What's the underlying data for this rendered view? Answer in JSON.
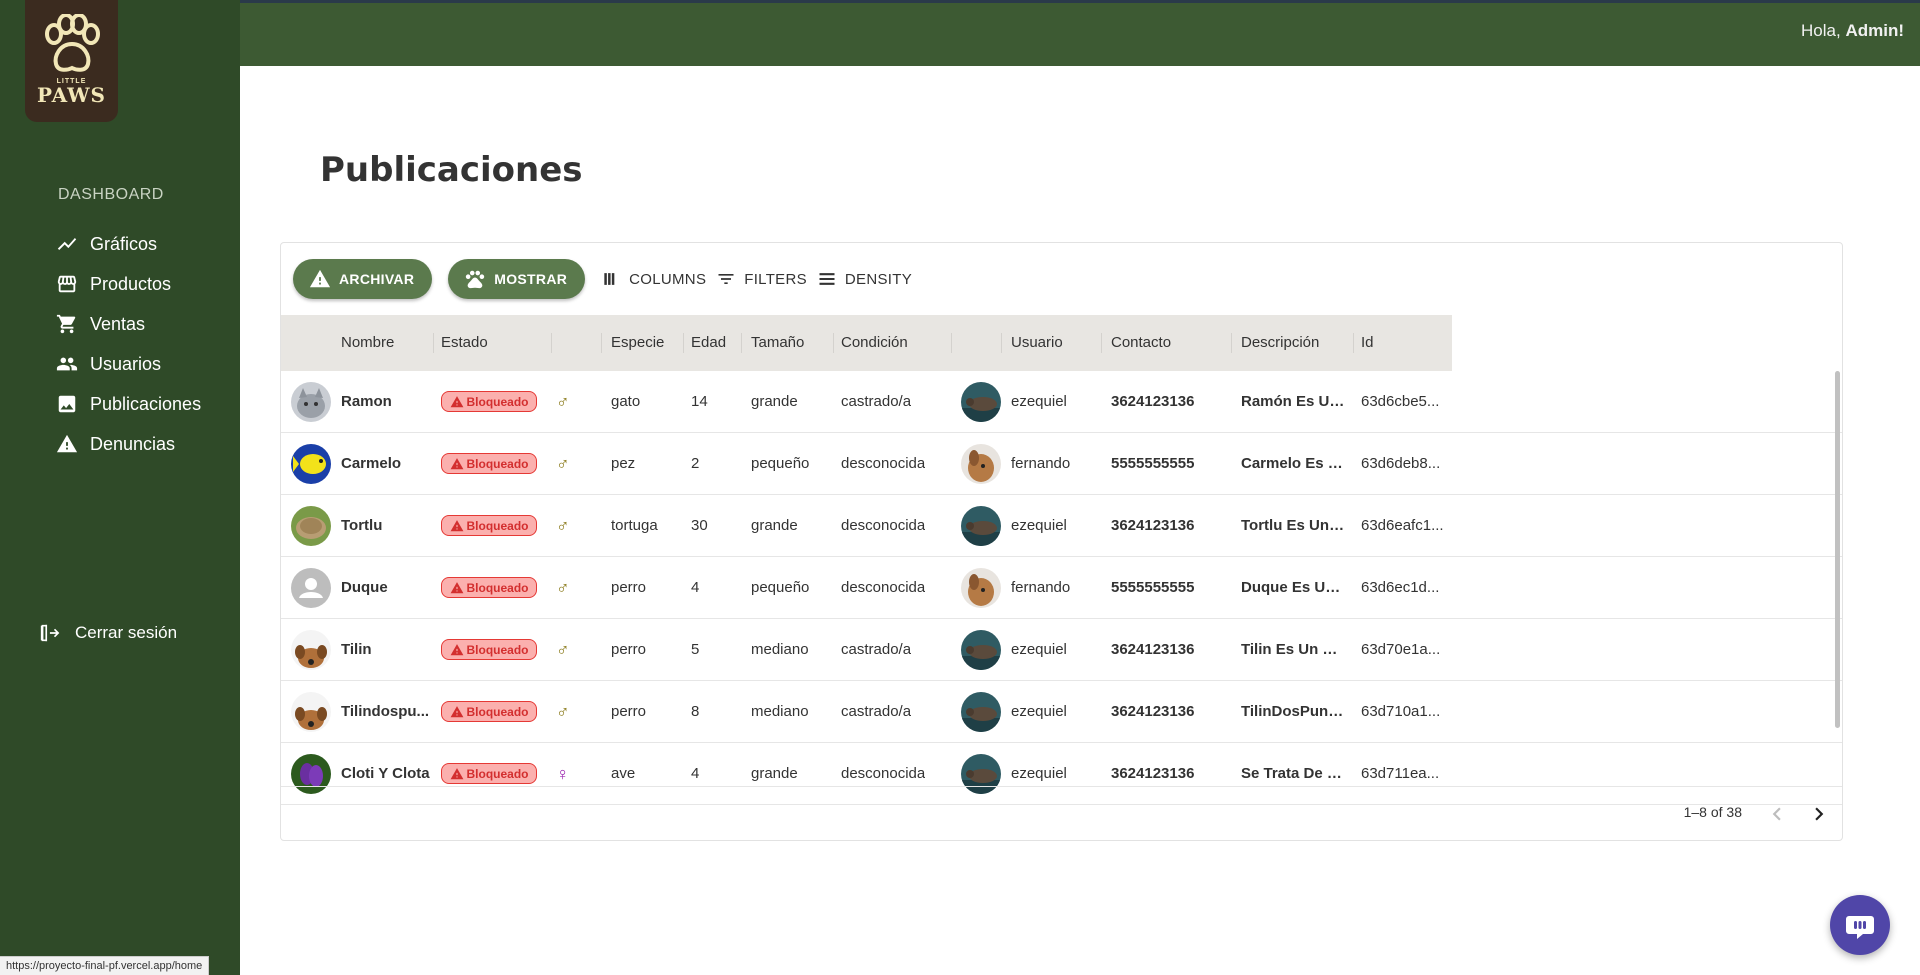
{
  "topbar": {
    "greeting_prefix": "Hola, ",
    "greeting_name": "Admin!"
  },
  "logo": {
    "small": "LITTLE",
    "big": "PAWS"
  },
  "sidebar": {
    "section_label": "DASHBOARD",
    "items": [
      {
        "label": "Gráficos",
        "icon": "chart-line-icon"
      },
      {
        "label": "Productos",
        "icon": "store-icon"
      },
      {
        "label": "Ventas",
        "icon": "cart-icon"
      },
      {
        "label": "Usuarios",
        "icon": "users-icon"
      },
      {
        "label": "Publicaciones",
        "icon": "image-icon"
      },
      {
        "label": "Denuncias",
        "icon": "warning-icon"
      }
    ],
    "logout_label": "Cerrar sesión"
  },
  "status_url": "https://proyecto-final-pf.vercel.app/home",
  "page": {
    "title": "Publicaciones"
  },
  "toolbar": {
    "archive_label": "ARCHIVAR",
    "show_label": "MOSTRAR",
    "columns_label": "COLUMNS",
    "filters_label": "FILTERS",
    "density_label": "DENSITY"
  },
  "table": {
    "headers": {
      "nombre": "Nombre",
      "estado": "Estado",
      "especie": "Especie",
      "edad": "Edad",
      "tamano": "Tamaño",
      "condicion": "Condición",
      "usuario": "Usuario",
      "contacto": "Contacto",
      "descripcion": "Descripción",
      "id": "Id"
    },
    "rows": [
      {
        "nombre": "Ramon",
        "estado": "Bloqueado",
        "genero": "♂",
        "especie": "gato",
        "edad": "14",
        "tamano": "grande",
        "condicion": "castrado/a",
        "usuario": "ezequiel",
        "contacto": "3624123136",
        "descripcion": "Ramón Es Un ...",
        "id": "63d6cbe5..."
      },
      {
        "nombre": "Carmelo",
        "estado": "Bloqueado",
        "genero": "♂",
        "especie": "pez",
        "edad": "2",
        "tamano": "pequeño",
        "condicion": "desconocida",
        "usuario": "fernando",
        "contacto": "5555555555",
        "descripcion": "Carmelo Es U...",
        "id": "63d6deb8..."
      },
      {
        "nombre": "Tortlu",
        "estado": "Bloqueado",
        "genero": "♂",
        "especie": "tortuga",
        "edad": "30",
        "tamano": "grande",
        "condicion": "desconocida",
        "usuario": "ezequiel",
        "contacto": "3624123136",
        "descripcion": "Tortlu Es Una ...",
        "id": "63d6eafc1..."
      },
      {
        "nombre": "Duque",
        "estado": "Bloqueado",
        "genero": "♂",
        "especie": "perro",
        "edad": "4",
        "tamano": "pequeño",
        "condicion": "desconocida",
        "usuario": "fernando",
        "contacto": "5555555555",
        "descripcion": "Duque Es Un ...",
        "id": "63d6ec1d..."
      },
      {
        "nombre": "Tilin",
        "estado": "Bloqueado",
        "genero": "♂",
        "especie": "perro",
        "edad": "5",
        "tamano": "mediano",
        "condicion": "castrado/a",
        "usuario": "ezequiel",
        "contacto": "3624123136",
        "descripcion": "Tilin Es Un Pe...",
        "id": "63d70e1a..."
      },
      {
        "nombre": "Tilindospu...",
        "estado": "Bloqueado",
        "genero": "♂",
        "especie": "perro",
        "edad": "8",
        "tamano": "mediano",
        "condicion": "castrado/a",
        "usuario": "ezequiel",
        "contacto": "3624123136",
        "descripcion": "TilinDosPunto...",
        "id": "63d710a1..."
      },
      {
        "nombre": "Cloti Y Clota",
        "estado": "Bloqueado",
        "genero": "♀",
        "especie": "ave",
        "edad": "4",
        "tamano": "grande",
        "condicion": "desconocida",
        "usuario": "ezequiel",
        "contacto": "3624123136",
        "descripcion": "Se Trata De U...",
        "id": "63d711ea..."
      }
    ]
  },
  "pagination": {
    "text": "1–8 of 38"
  },
  "colors": {
    "sidebar": "#2f4a28",
    "topbar": "#3d5a33",
    "button": "#5b7a4d",
    "badge_bg": "#fbb0ae",
    "badge_text": "#d32f2f",
    "chat": "#5046a8"
  }
}
